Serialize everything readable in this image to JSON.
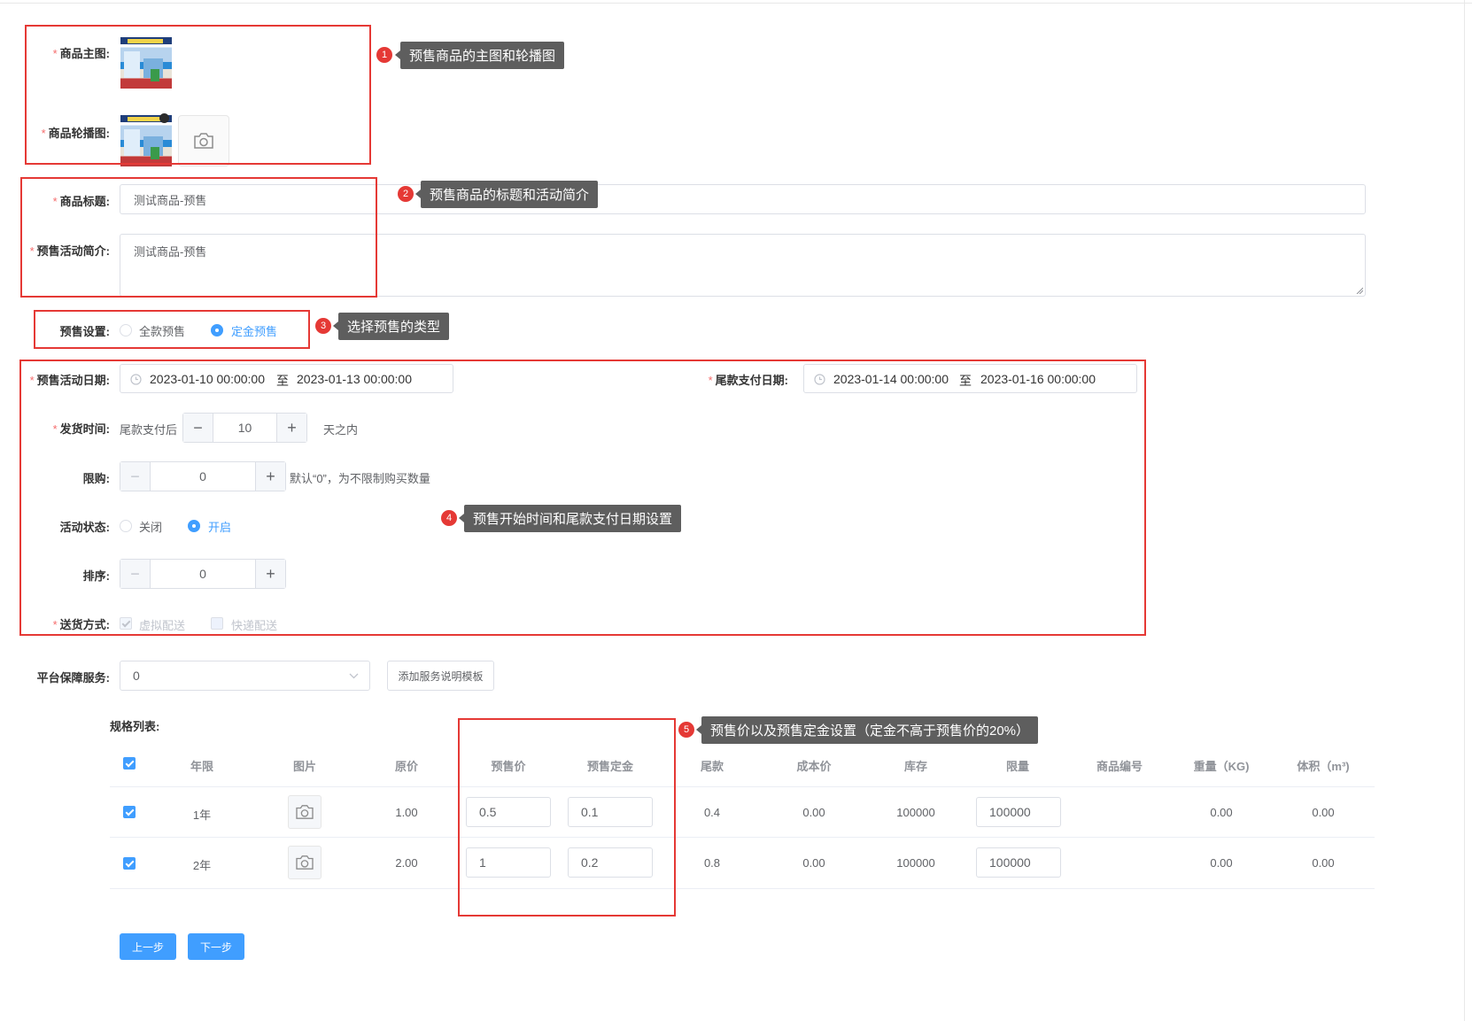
{
  "form": {
    "main_image_label": "商品主图:",
    "carousel_label": "商品轮播图:",
    "title_label": "商品标题:",
    "title_value": "测试商品-预售",
    "intro_label": "预售活动简介:",
    "intro_value": "测试商品-预售",
    "presale_setting_label": "预售设置:",
    "presale_options": [
      "全款预售",
      "定金预售"
    ],
    "presale_selected": "定金预售",
    "activity_date_label": "预售活动日期:",
    "activity_start": "2023-01-10 00:00:00",
    "activity_end": "2023-01-13 00:00:00",
    "range_sep": "至",
    "final_pay_label": "尾款支付日期:",
    "final_start": "2023-01-14 00:00:00",
    "final_end": "2023-01-16 00:00:00",
    "ship_label": "发货时间:",
    "ship_prefix": "尾款支付后",
    "ship_days": "10",
    "ship_suffix": "天之内",
    "limit_label": "限购:",
    "limit_value": "0",
    "limit_hint": "默认“0”，为不限制购买数量",
    "status_label": "活动状态:",
    "status_options": [
      "关闭",
      "开启"
    ],
    "status_selected": "开启",
    "sort_label": "排序:",
    "sort_value": "0",
    "delivery_label": "送货方式:",
    "delivery_options": [
      "虚拟配送",
      "快递配送"
    ],
    "guarantee_label": "平台保障服务:",
    "guarantee_value": "0",
    "add_template_button": "添加服务说明模板",
    "spec_label": "规格列表:",
    "prev_button": "上一步",
    "next_button": "下一步"
  },
  "table": {
    "headers": [
      "年限",
      "图片",
      "原价",
      "预售价",
      "预售定金",
      "尾款",
      "成本价",
      "库存",
      "限量",
      "商品编号",
      "重量（KG)",
      "体积（m³)"
    ],
    "rows": [
      {
        "year": "1年",
        "price": "1.00",
        "presale_price": "0.5",
        "deposit": "0.1",
        "balance": "0.4",
        "cost": "0.00",
        "stock": "100000",
        "limit": "100000",
        "code": "",
        "weight": "0.00",
        "volume": "0.00"
      },
      {
        "year": "2年",
        "price": "2.00",
        "presale_price": "1",
        "deposit": "0.2",
        "balance": "0.8",
        "cost": "0.00",
        "stock": "100000",
        "limit": "100000",
        "code": "",
        "weight": "0.00",
        "volume": "0.00"
      }
    ]
  },
  "annotations": [
    {
      "num": "1",
      "text": "预售商品的主图和轮播图"
    },
    {
      "num": "2",
      "text": "预售商品的标题和活动简介"
    },
    {
      "num": "3",
      "text": "选择预售的类型"
    },
    {
      "num": "4",
      "text": "预售开始时间和尾款支付日期设置"
    },
    {
      "num": "5",
      "text": "预售价以及预售定金设置（定金不高于预售价的20%）"
    }
  ],
  "colors": {
    "primary": "#409eff",
    "required": "#f56c6c",
    "annotation_red": "#e53935",
    "tooltip_bg": "#5e5e5e"
  },
  "icons": [
    "camera-icon",
    "clock-icon",
    "chevron-down-icon",
    "check-icon"
  ]
}
